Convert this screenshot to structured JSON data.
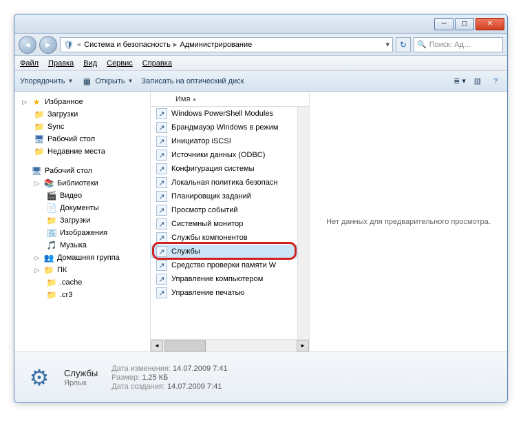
{
  "titlebar": {},
  "address": {
    "segments": [
      "Система и безопасность",
      "Администрирование"
    ],
    "prefix": "«"
  },
  "search": {
    "placeholder": "Поиск: Ад…"
  },
  "menu": {
    "file": "Файл",
    "edit": "Правка",
    "view": "Вид",
    "tools": "Сервис",
    "help": "Справка"
  },
  "toolbar": {
    "organize": "Упорядочить",
    "open": "Открыть",
    "burn": "Записать на оптический диск"
  },
  "columns": {
    "name": "Имя"
  },
  "nav": {
    "favorites": "Избранное",
    "fav_items": [
      "Загрузки",
      "Sync",
      "Рабочий стол",
      "Недавние места"
    ],
    "desktop": "Рабочий стол",
    "libraries": "Библиотеки",
    "lib_items": [
      "Видео",
      "Документы",
      "Загрузки",
      "Изображения",
      "Музыка"
    ],
    "homegroup": "Домашняя группа",
    "pc": "ПК",
    "pc_items": [
      ".cache",
      ".cr3"
    ]
  },
  "items": [
    "Windows PowerShell Modules",
    "Брандмауэр Windows в режим",
    "Инициатор iSCSI",
    "Источники данных (ODBC)",
    "Конфигурация системы",
    "Локальная политика безопасн",
    "Планировщик заданий",
    "Просмотр событий",
    "Системный монитор",
    "Службы компонентов",
    "Службы",
    "Средство проверки памяти W",
    "Управление компьютером",
    "Управление печатью"
  ],
  "selected_index": 10,
  "preview": {
    "no_data": "Нет данных для предварительного просмотра."
  },
  "details": {
    "name": "Службы",
    "type": "Ярлык",
    "date_modified_label": "Дата изменения:",
    "date_modified": "14.07.2009 7:41",
    "size_label": "Размер:",
    "size": "1,25 КБ",
    "date_created_label": "Дата создания:",
    "date_created": "14.07.2009 7:41"
  }
}
